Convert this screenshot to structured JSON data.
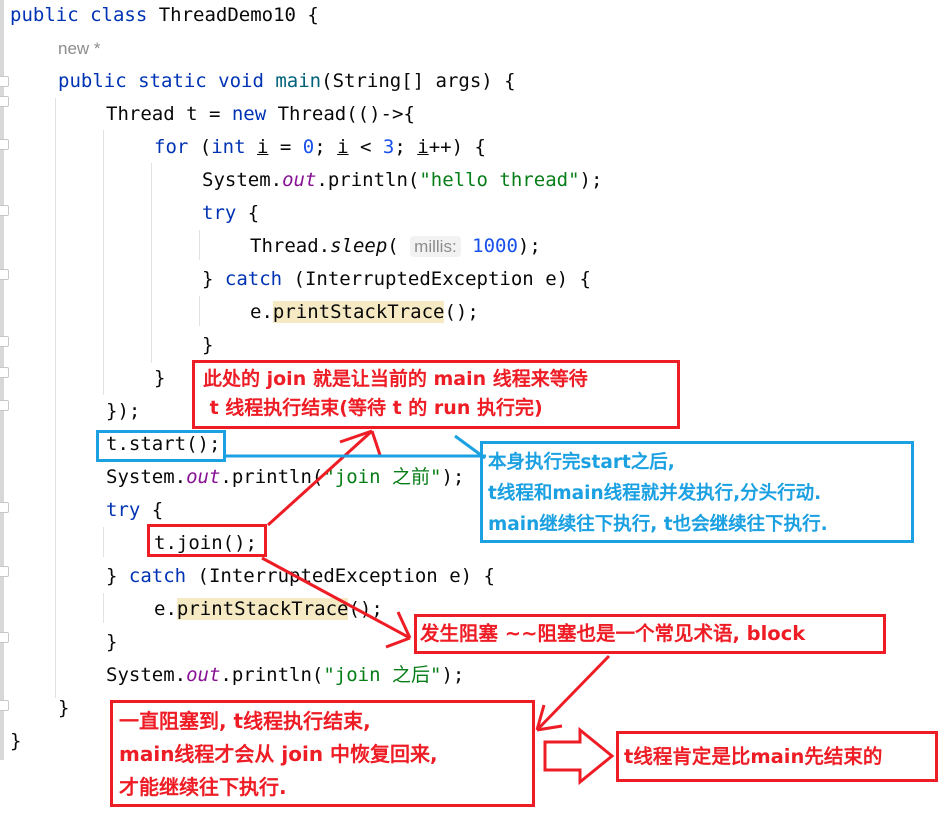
{
  "editor": {
    "usage_hint": "new *",
    "param_hint": "millis:",
    "lines": {
      "class_decl": {
        "kw": "public class",
        "name": " ThreadDemo10 {"
      },
      "main_decl": {
        "kw1": "public static void",
        "fn": "main",
        "rest": "(String[] args) {"
      },
      "thread_decl": {
        "pre": "Thread t = ",
        "kw": "new",
        "post": " Thread(()->{"
      },
      "for_loop": {
        "kw": "for",
        "a": " (",
        "kw2": "int",
        "b": " ",
        "i1": "i",
        "c": " = ",
        "n0": "0",
        "d": "; ",
        "i2": "i",
        "e": " < ",
        "n3": "3",
        "f": "; ",
        "i3": "i",
        "g": "++) {"
      },
      "println_hello": {
        "a": "System.",
        "out": "out",
        "b": ".println(",
        "str": "\"hello thread\"",
        "c": ");"
      },
      "try1": {
        "kw": "try",
        "rest": " {"
      },
      "sleep": {
        "a": "Thread.",
        "m": "sleep",
        "b": "( ",
        "num": "1000",
        "c": ");"
      },
      "catch1": {
        "a": "} ",
        "kw": "catch",
        "rest": " (InterruptedException e) {"
      },
      "pst1": {
        "a": "e.",
        "hl": "printStackTrace",
        "b": "();"
      },
      "close1": "}",
      "close2": "}",
      "close_lambda": "});",
      "start": "t.start();",
      "println_before": {
        "a": "System.",
        "out": "out",
        "b": ".println(",
        "str": "\"join 之前\"",
        "c": ");"
      },
      "try2": {
        "kw": "try",
        "rest": " {"
      },
      "join": "t.join();",
      "catch2": {
        "a": "} ",
        "kw": "catch",
        "rest": " (InterruptedException e) {"
      },
      "pst2": {
        "a": "e.",
        "hl": "printStackTrace",
        "b": "();"
      },
      "close3": "}",
      "println_after": {
        "a": "System.",
        "out": "out",
        "b": ".println(",
        "str": "\"join 之后\"",
        "c": ");"
      },
      "close_main": "}",
      "close_class": "}"
    }
  },
  "annotations": {
    "join_explain": "此处的 join 就是让当前的 main 线程来等待\n t 线程执行结束(等待 t 的 run 执行完)",
    "start_explain": "本身执行完start之后,\nt线程和main线程就并发执行,分头行动.\nmain继续往下执行, t也会继续往下执行.",
    "block_note": "发生阻塞 ~~阻塞也是一个常见术语, block",
    "block_until": "一直阻塞到, t线程执行结束,\nmain线程才会从 join 中恢复回来,\n才能继续往下执行.",
    "conclusion": "t线程肯定是比main先结束的"
  },
  "colors": {
    "annotation_red": "#ee1c25",
    "annotation_blue": "#1ba1e2"
  }
}
